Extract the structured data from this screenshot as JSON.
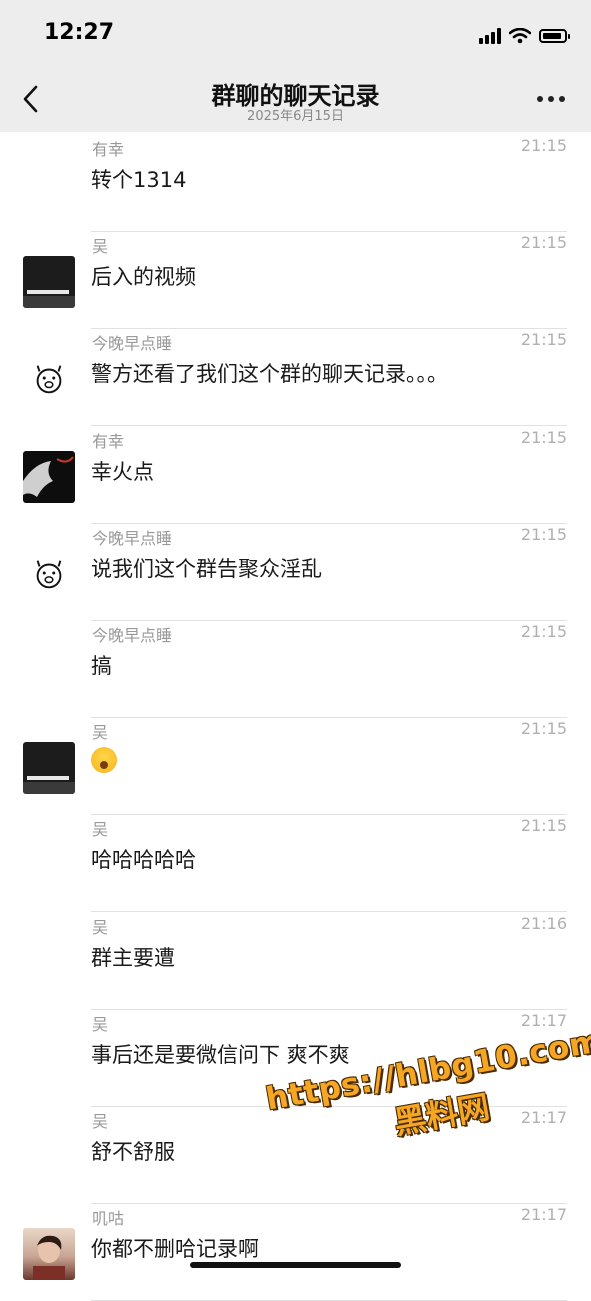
{
  "status_bar": {
    "time": "12:27"
  },
  "nav": {
    "title": "群聊的聊天记录",
    "subtitle": "2025年6月15日",
    "back_icon": "chevron-left-icon",
    "more_icon": "ellipsis-icon"
  },
  "messages": [
    {
      "name": "有幸",
      "time": "21:15",
      "text": "转个1314",
      "avatar": "none"
    },
    {
      "name": "吴",
      "time": "21:15",
      "text": "后入的视频",
      "avatar": "dark-video"
    },
    {
      "name": "今晚早点睡",
      "time": "21:15",
      "text": "警方还看了我们这个群的聊天记录。。。",
      "avatar": "pig-face"
    },
    {
      "name": "有幸",
      "time": "21:15",
      "text": "幸火点",
      "avatar": "dark-art"
    },
    {
      "name": "今晚早点睡",
      "time": "21:15",
      "text": "说我们这个群告聚众淫乱",
      "avatar": "pig-face"
    },
    {
      "name": "今晚早点睡",
      "time": "21:15",
      "text": "搞",
      "avatar": "none"
    },
    {
      "name": "吴",
      "time": "21:15",
      "text": "",
      "emoji": "surprised-face-emoji",
      "avatar": "dark-video"
    },
    {
      "name": "吴",
      "time": "21:15",
      "text": "哈哈哈哈哈",
      "avatar": "none"
    },
    {
      "name": "吴",
      "time": "21:16",
      "text": "群主要遭",
      "avatar": "none"
    },
    {
      "name": "吴",
      "time": "21:17",
      "text": "事后还是要微信问下 爽不爽",
      "avatar": "none"
    },
    {
      "name": "吴",
      "time": "21:17",
      "text": "舒不舒服",
      "avatar": "none"
    },
    {
      "name": "叽咕",
      "time": "21:17",
      "text": "你都不删哈记录啊",
      "avatar": "photo"
    }
  ],
  "watermark": {
    "url": "https://hlbg10.com",
    "label": "黑料网"
  }
}
